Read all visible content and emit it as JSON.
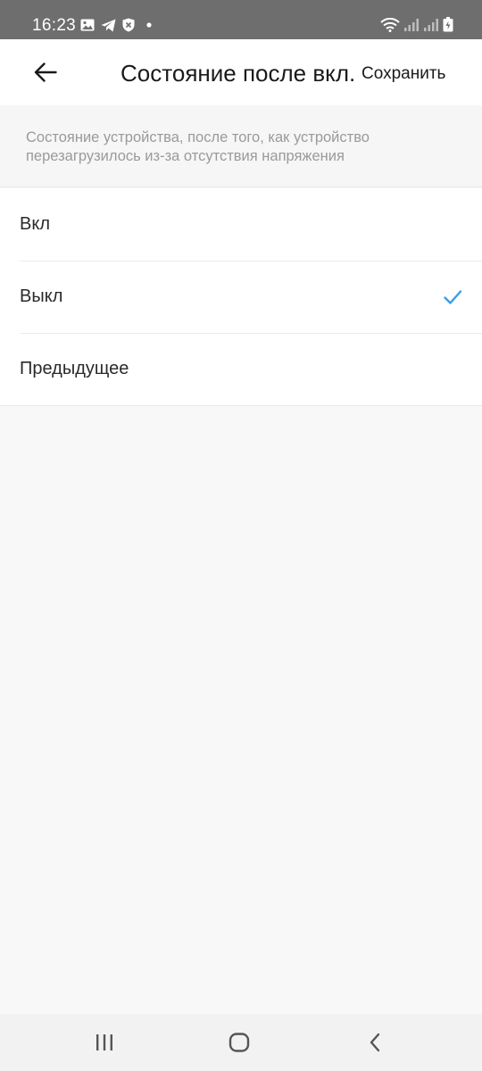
{
  "status_bar": {
    "time": "16:23",
    "left_icons": [
      "image-icon",
      "telegram-icon",
      "shield-icon",
      "dot-icon"
    ],
    "right_icons": [
      "wifi-icon",
      "signal-icon",
      "signal-icon",
      "battery-icon"
    ]
  },
  "app_bar": {
    "back_icon": "arrow-left-icon",
    "title": "Состояние после вкл.",
    "save_label": "Сохранить"
  },
  "description": "Состояние устройства, после того, как устройство перезагрузилось из-за отсутствия напряжения",
  "options": [
    {
      "label": "Вкл",
      "selected": false
    },
    {
      "label": "Выкл",
      "selected": true
    },
    {
      "label": "Предыдущее",
      "selected": false
    }
  ],
  "colors": {
    "accent": "#3a9ee8",
    "status_bar_bg": "#6e6e6e",
    "page_bg": "#f8f8f8"
  },
  "nav_bar": {
    "buttons": [
      "recent-apps-icon",
      "home-icon",
      "back-nav-icon"
    ]
  }
}
